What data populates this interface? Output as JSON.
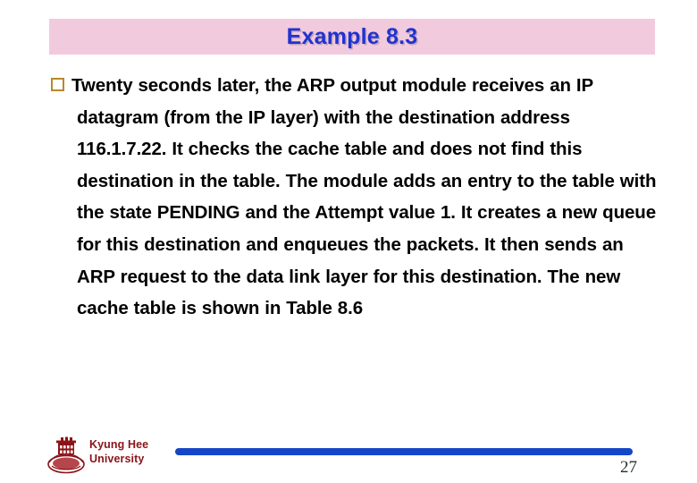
{
  "slide": {
    "title": "Example 8.3",
    "title_color": "#2233cc",
    "title_band_color": "#f2cadd",
    "background_color": "#ffffff"
  },
  "content": {
    "bullet_icon": "hollow-square-bullet",
    "bullet_color": "#b8892a",
    "paragraph": "Twenty seconds later, the ARP output module receives an IP datagram (from the IP layer) with the destination address 116.1.7.22. It checks the cache table and does not find this destination in the table. The module adds an entry to the table with the state PENDING and the Attempt value 1. It creates a new queue for this destination and enqueues the packets. It then sends an ARP request to the data link layer for this destination. The new cache table is shown in Table 8.6"
  },
  "footer": {
    "logo_icon": "kyung-hee-university-crest",
    "organization_line_1": "Kyung Hee",
    "organization_line_2": "University",
    "organization_color": "#8c1318",
    "rule_color": "#1546c8",
    "page_number": "27"
  }
}
